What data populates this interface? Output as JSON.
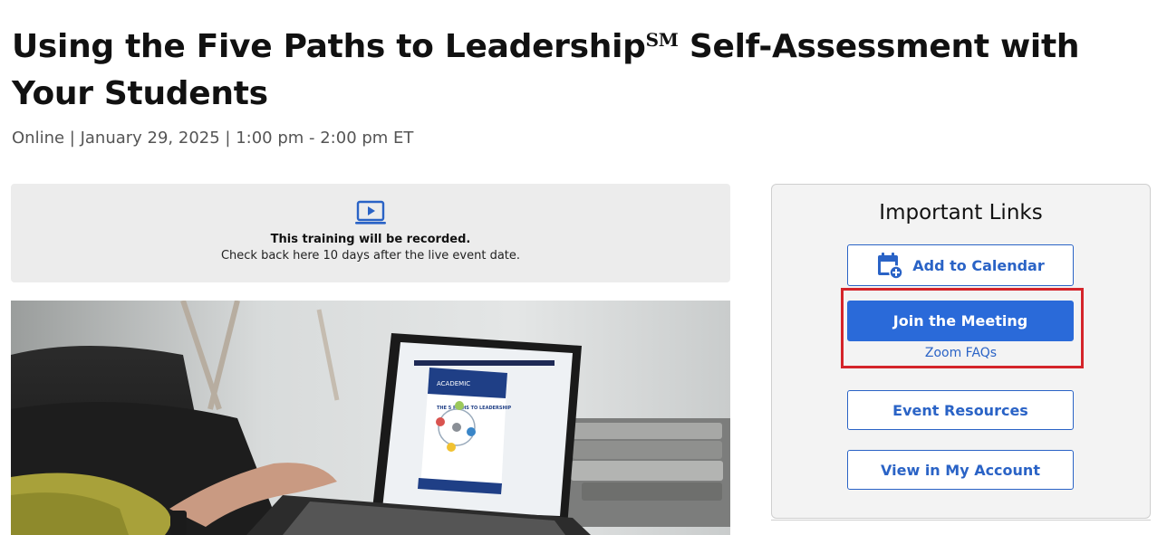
{
  "header": {
    "title_part1": "Using the Five Paths to Leadership",
    "title_mark": "SM",
    "title_part2": " Self-Assessment with Your Students",
    "meta": "Online | January 29, 2025 | 1:00 pm - 2:00 pm ET"
  },
  "recording_notice": {
    "icon": "video-play-icon",
    "headline": "This training will be recorded.",
    "subtext": "Check back here 10 days after the live event date."
  },
  "photo": {
    "screen_brand": "ACADEMIC",
    "screen_heading": "THE 5 PATHS TO LEADERSHIP"
  },
  "important_links": {
    "title": "Important Links",
    "add_to_calendar": "Add to Calendar",
    "join_meeting": "Join the Meeting",
    "zoom_faqs": "Zoom FAQs",
    "event_resources": "Event Resources",
    "view_account": "View in My Account"
  },
  "colors": {
    "accent": "#2a6ad9",
    "link": "#2a63c6",
    "highlight": "#d4242a"
  }
}
